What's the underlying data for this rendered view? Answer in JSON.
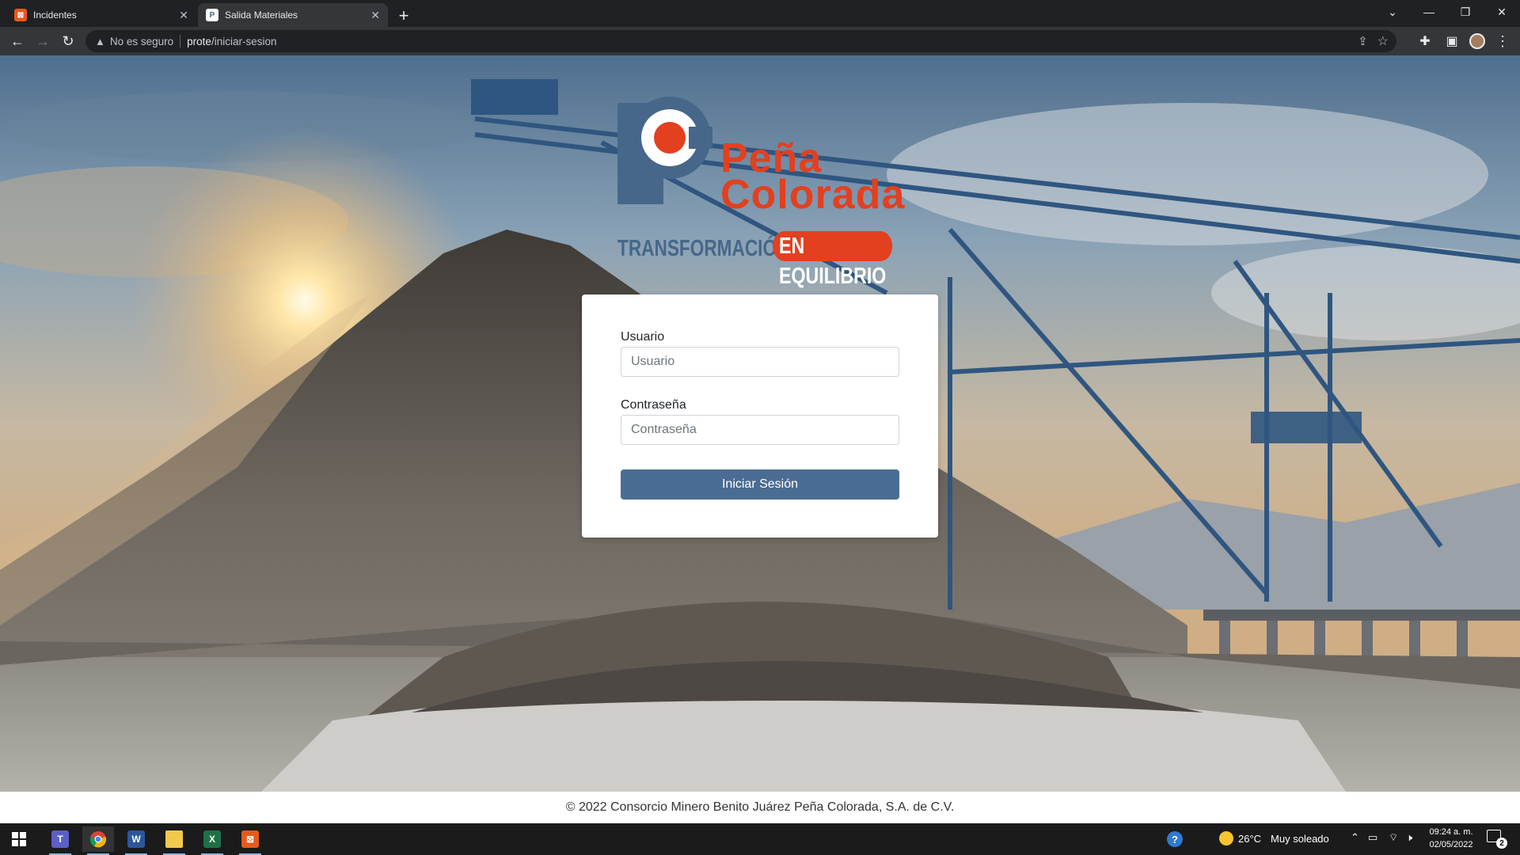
{
  "browser": {
    "tabs": [
      {
        "title": "Incidentes",
        "active": false
      },
      {
        "title": "Salida Materiales",
        "active": true
      }
    ],
    "security_label": "No es seguro",
    "url_host": "prote",
    "url_path": "/iniciar-sesion"
  },
  "logo": {
    "brand_line1": "Peña",
    "brand_line2": "Colorada",
    "tagline_part1": "TRANSFORMACIÓN",
    "tagline_part2": "EN EQUILIBRIO"
  },
  "login": {
    "user_label": "Usuario",
    "user_placeholder": "Usuario",
    "password_label": "Contraseña",
    "password_placeholder": "Contraseña",
    "submit_label": "Iniciar Sesión"
  },
  "footer": {
    "copyright": "© 2022 Consorcio Minero Benito Juárez Peña Colorada, S.A. de C.V."
  },
  "taskbar": {
    "weather_temp": "26°C",
    "weather_desc": "Muy soleado",
    "time": "09:24 a. m.",
    "date": "02/05/2022",
    "notification_count": "2"
  },
  "colors": {
    "brand_red": "#e2401f",
    "brand_blue": "#46678a",
    "button_blue": "#4a6c93"
  }
}
